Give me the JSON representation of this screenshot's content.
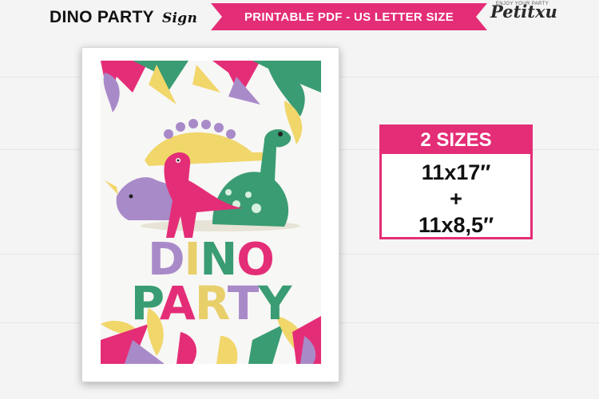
{
  "header": {
    "title": "DINO PARTY",
    "title_sub": "Sign",
    "banner": "PRINTABLE PDF - US LETTER SIZE",
    "logo_word": "Petitxu",
    "logo_tag": "ENJOY YOUR PARTY"
  },
  "poster": {
    "line1": [
      "D",
      "I",
      "N",
      "O"
    ],
    "line2": [
      "P",
      "A",
      "R",
      "T",
      "Y"
    ],
    "letter_colors": [
      "#a98ac9",
      "#e8cf6a",
      "#3a9c72",
      "#e42d77"
    ]
  },
  "sizes": {
    "heading": "2 SIZES",
    "size_a": "11x17″",
    "plus": "+",
    "size_b": "11x8,5″"
  },
  "colors": {
    "accent": "#e42d77",
    "green": "#3a9c72",
    "yellow": "#f1d66a",
    "purple": "#a98ac9"
  }
}
